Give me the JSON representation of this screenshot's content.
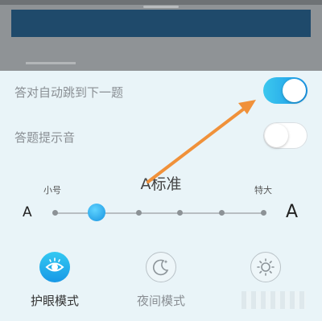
{
  "settings": {
    "auto_next_label": "答对自动跳到下一题",
    "auto_next_on": true,
    "sound_label": "答题提示音",
    "sound_on": false
  },
  "font_size": {
    "small_label": "小号",
    "large_label": "特大",
    "current_label": "A标准",
    "a_small": "A",
    "a_large": "A",
    "steps": 6,
    "selected_step": 1
  },
  "modes": [
    {
      "label": "护眼模式",
      "icon": "eye-icon",
      "active": true
    },
    {
      "label": "夜间模式",
      "icon": "moon-icon",
      "active": false
    },
    {
      "label": "",
      "icon": "sun-icon",
      "active": false
    }
  ],
  "colors": {
    "accent": "#1a97e8",
    "annotation_arrow": "#f0913a",
    "panel_bg": "#e9f4f8"
  }
}
